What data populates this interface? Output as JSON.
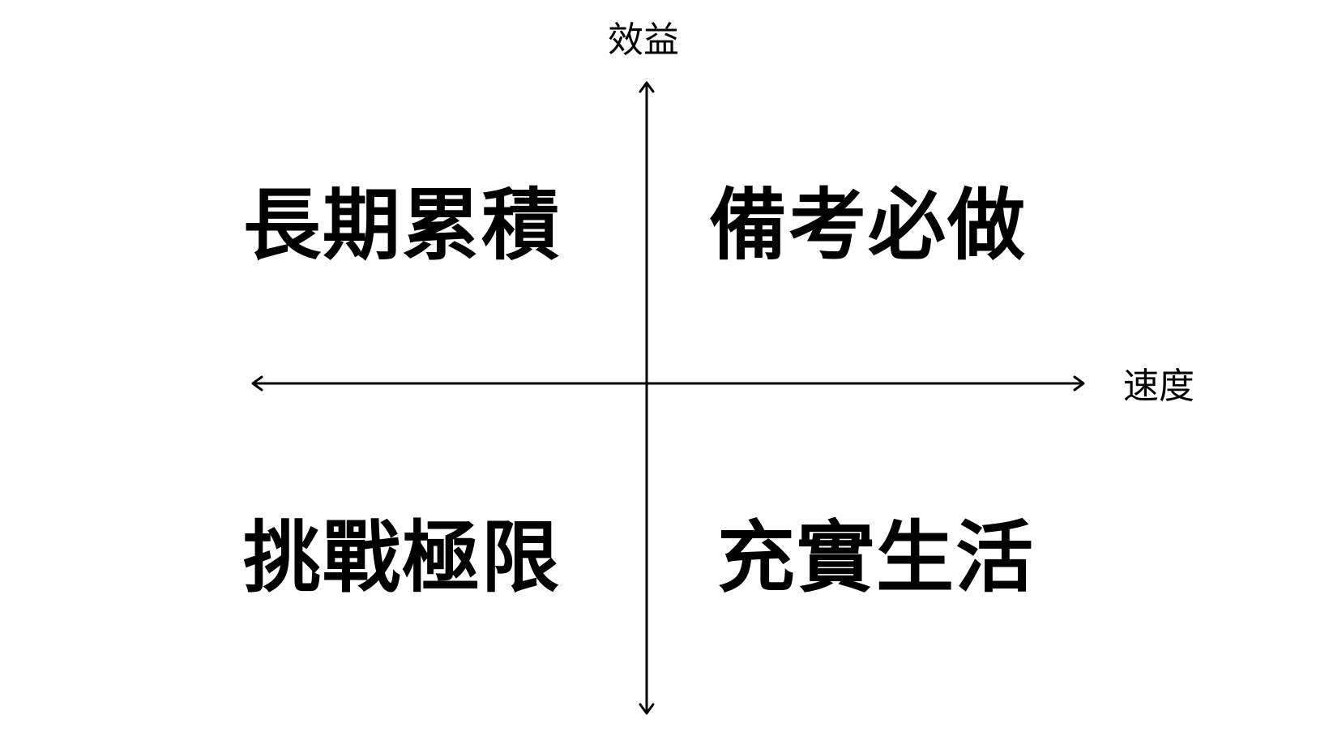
{
  "axes": {
    "y_label": "效益",
    "x_label": "速度"
  },
  "quadrants": {
    "top_left": "長期累積",
    "top_right": "備考必做",
    "bottom_left": "挑戰極限",
    "bottom_right": "充實生活"
  },
  "colors": {
    "line": "#000000",
    "text": "#000000",
    "background": "#ffffff"
  }
}
